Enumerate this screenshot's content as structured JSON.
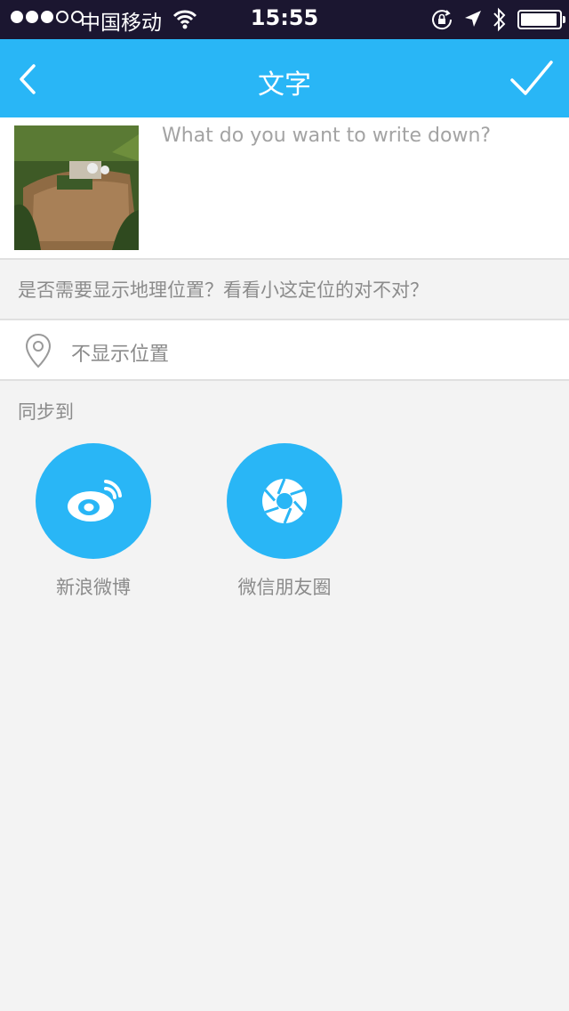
{
  "status_bar": {
    "carrier": "中国移动",
    "time": "15:55",
    "signal_filled": 3,
    "signal_total": 5,
    "battery_level": 0.95
  },
  "nav": {
    "title": "文字",
    "back_icon": "chevron-left-icon",
    "done_icon": "checkmark-icon"
  },
  "compose": {
    "placeholder": "What do you want to write down?",
    "value": ""
  },
  "location": {
    "prompt": "是否需要显示地理位置？看看小这定位的对不对？",
    "value": "不显示位置"
  },
  "sync": {
    "label": "同步到",
    "targets": [
      {
        "name": "新浪微博",
        "icon": "weibo-icon"
      },
      {
        "name": "微信朋友圈",
        "icon": "wechat-moments-icon"
      }
    ]
  },
  "colors": {
    "accent": "#29b6f6",
    "status_bar": "#1b1630",
    "background": "#f3f3f3",
    "secondary_text": "#8b8b8b"
  }
}
